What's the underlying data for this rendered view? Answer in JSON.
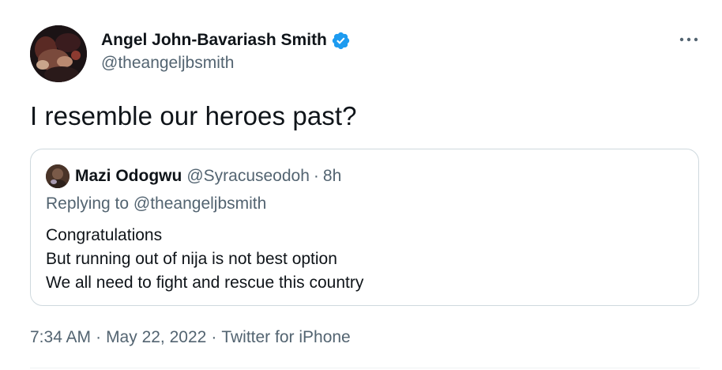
{
  "author": {
    "display_name": "Angel John-Bavariash Smith",
    "handle": "@theangeljbsmith",
    "verified_icon": "verified-badge-icon"
  },
  "tweet": {
    "text": "I resemble our heroes past?"
  },
  "quoted_tweet": {
    "display_name": "Mazi Odogwu",
    "handle": "@Syracuseodoh",
    "separator": "·",
    "time": "8h",
    "replying_to": "Replying to @theangeljbsmith",
    "lines": [
      "Congratulations",
      "But running out of nija is not best option",
      "We all need to fight and rescue this country"
    ]
  },
  "meta": {
    "time": "7:34 AM",
    "separator_1": "·",
    "date": "May 22, 2022",
    "separator_2": "·",
    "source": "Twitter for iPhone"
  },
  "colors": {
    "text_primary": "#0f1419",
    "text_secondary": "#536471",
    "verified_blue": "#1d9bf0",
    "border": "#cfd9de"
  },
  "icons": {
    "more": "more-horizontal-icon",
    "verified": "verified-badge-icon"
  }
}
